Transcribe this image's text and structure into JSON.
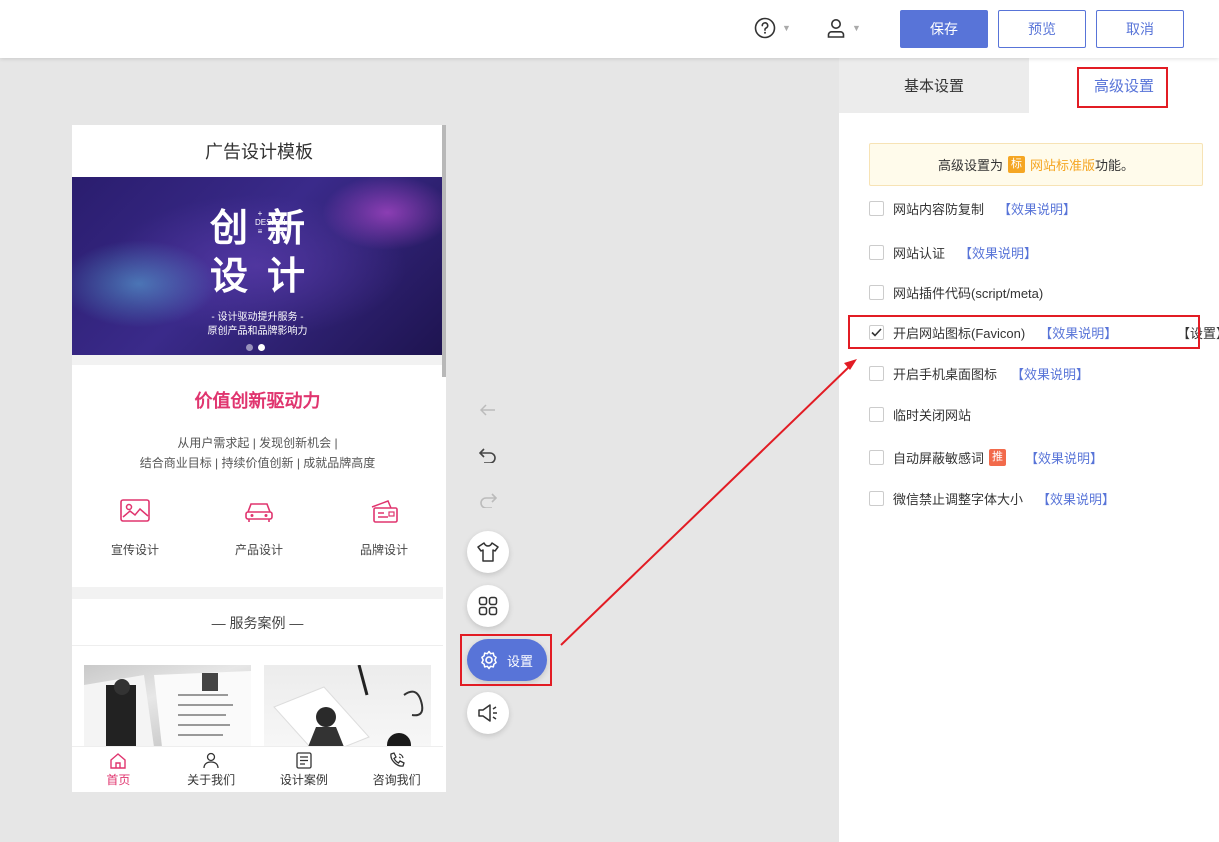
{
  "header": {
    "save_label": "保存",
    "preview_label": "预览",
    "cancel_label": "取消",
    "help_icon": "help-circle-icon",
    "user_icon": "user-icon"
  },
  "phone": {
    "title": "广告设计模板",
    "banner": {
      "big_chars": [
        "创",
        "新",
        "设",
        "计"
      ],
      "design_word": "+ DESIGN ≡",
      "line1": "- 设计驱动提升服务 -",
      "line2": "原创产品和品牌影响力"
    },
    "headline": "价值创新驱动力",
    "desc_line1": "从用户需求起 | 发现创新机会 |",
    "desc_line2": "结合商业目标 | 持续价值创新 | 成就品牌高度",
    "features": [
      {
        "label": "宣传设计",
        "icon": "image-frame-icon"
      },
      {
        "label": "产品设计",
        "icon": "car-icon"
      },
      {
        "label": "品牌设计",
        "icon": "card-icon"
      }
    ],
    "section_title": "—   服务案例   —",
    "tabs": [
      {
        "label": "首页",
        "icon": "home-icon"
      },
      {
        "label": "关于我们",
        "icon": "person-icon"
      },
      {
        "label": "设计案例",
        "icon": "document-icon"
      },
      {
        "label": "咨询我们",
        "icon": "phone-icon"
      }
    ]
  },
  "tools": {
    "settings_label": "设置"
  },
  "panel": {
    "tab_basic": "基本设置",
    "tab_advanced": "高级设置",
    "notice_prefix": "高级设置为",
    "notice_badge": "标",
    "notice_highlight": "网站标准版",
    "notice_suffix": "功能。",
    "options": [
      {
        "label": "网站内容防复制",
        "link": "【效果说明】",
        "checked": false
      },
      {
        "label": "网站认证",
        "link": "【效果说明】",
        "checked": false
      },
      {
        "label": "网站插件代码(script/meta)",
        "link": "",
        "checked": false
      },
      {
        "label": "开启网站图标(Favicon)",
        "link": "【效果说明】",
        "extra": "【设置】",
        "checked": true
      },
      {
        "label": "开启手机桌面图标",
        "link": "【效果说明】",
        "checked": false
      },
      {
        "label": "临时关闭网站",
        "link": "",
        "checked": false
      },
      {
        "label": "自动屏蔽敏感词",
        "badge": "推",
        "link": "【效果说明】",
        "checked": false
      },
      {
        "label": "微信禁止调整字体大小",
        "link": "【效果说明】",
        "checked": false
      }
    ]
  },
  "colors": {
    "primary": "#5874d8",
    "accent_pink": "#e0356f",
    "highlight_red": "#e21c24",
    "badge_orange": "#f5a623"
  }
}
